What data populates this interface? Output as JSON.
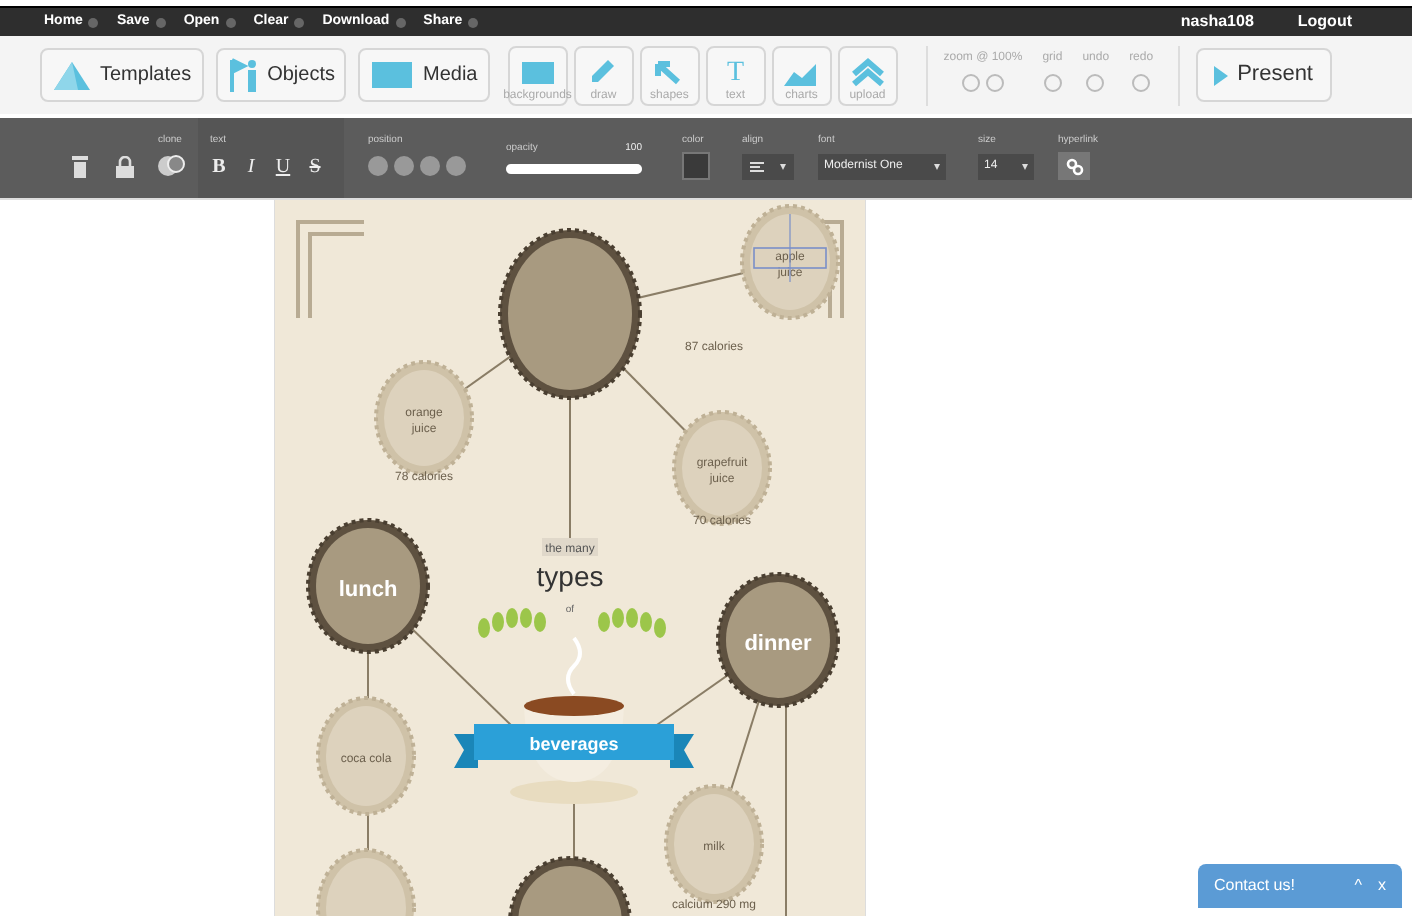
{
  "menu": [
    "Home",
    "Save",
    "Open",
    "Clear",
    "Download",
    "Share"
  ],
  "user": {
    "name": "nasha108",
    "logout": "Logout"
  },
  "toolbar": {
    "big": [
      {
        "kind": "templates",
        "label": "Templates"
      },
      {
        "kind": "objects",
        "label": "Objects"
      },
      {
        "kind": "media",
        "label": "Media"
      }
    ],
    "small": [
      {
        "kind": "backgrounds",
        "label": "backgrounds"
      },
      {
        "kind": "draw",
        "label": "draw"
      },
      {
        "kind": "shapes",
        "label": "shapes"
      },
      {
        "kind": "text",
        "label": "text",
        "glyph": "T"
      },
      {
        "kind": "charts",
        "label": "charts"
      },
      {
        "kind": "upload",
        "label": "upload"
      }
    ],
    "zoom_label": "zoom @ 100%",
    "grid_label": "grid",
    "undo_label": "undo",
    "redo_label": "redo",
    "present": "Present"
  },
  "format": {
    "clone_label": "clone",
    "text_label": "text",
    "text_buttons": [
      "B",
      "I",
      "U",
      "S"
    ],
    "position_label": "position",
    "opacity_label": "opacity",
    "opacity_value": "100",
    "opacity": {
      "level": 1.0
    },
    "color_label": "color",
    "align_label": "align",
    "font_label": "font",
    "font": "Modernist One",
    "size_label": "size",
    "size": "14",
    "hyperlink_label": "hyperlink"
  },
  "infographic": {
    "title_top": "the many",
    "title_main": "types",
    "title_of": "of",
    "ribbon": "beverages",
    "nodes": [
      {
        "label": "apple juice",
        "caption": "87 calories",
        "selected": true
      },
      {
        "label": "orange juice",
        "caption": "78 calories",
        "selected": false
      },
      {
        "label": "grapefruit juice",
        "caption": "70 calories",
        "selected": false
      },
      {
        "label": "lunch",
        "selected": false
      },
      {
        "label": "dinner",
        "selected": false
      },
      {
        "label": "coca cola",
        "selected": false
      },
      {
        "label": "milk",
        "caption": "calcium 290 mg",
        "selected": false
      }
    ]
  },
  "contact": {
    "label": "Contact us!",
    "minimize": "^",
    "close": "x"
  }
}
